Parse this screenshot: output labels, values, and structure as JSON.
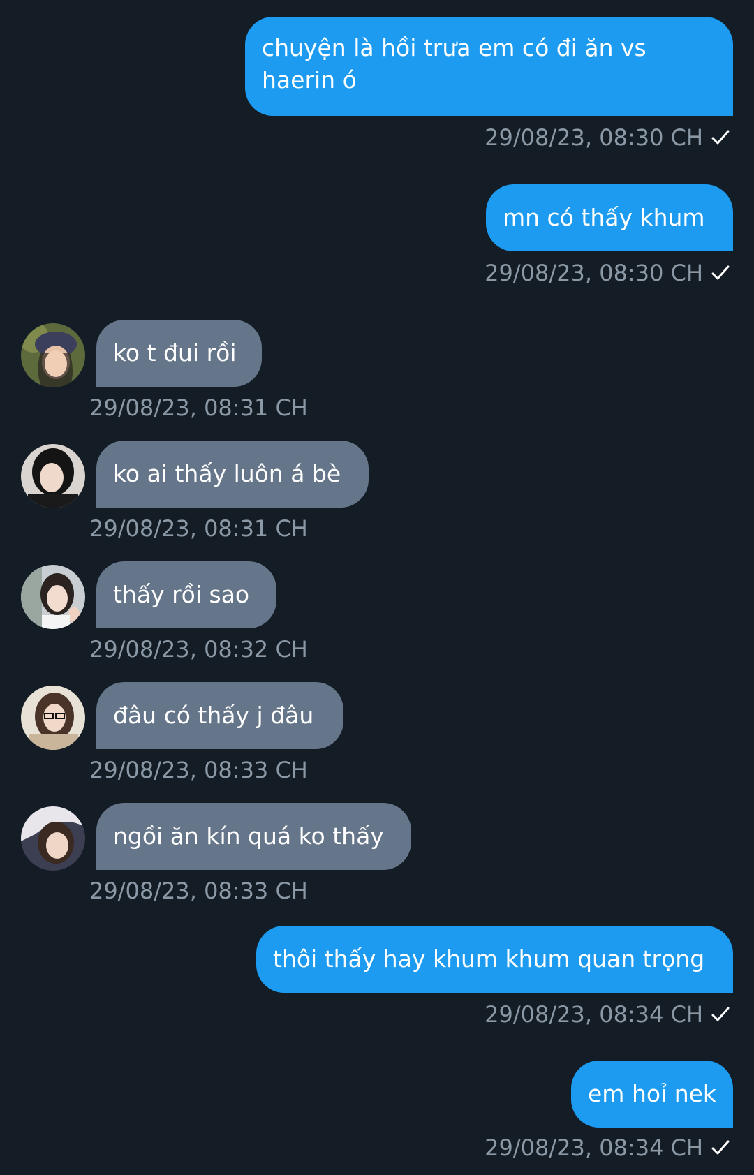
{
  "messages": [
    {
      "direction": "outgoing",
      "text": "chuyện là hồi trưa em có đi ăn vs haerin ó",
      "timestamp": "29/08/23,  08:30 CH",
      "status_icon": "check-icon"
    },
    {
      "direction": "outgoing",
      "text": "mn có thấy khum",
      "timestamp": "29/08/23,  08:30 CH",
      "status_icon": "check-icon"
    },
    {
      "direction": "incoming",
      "text": "ko t đui rồi",
      "timestamp": "29/08/23,  08:31 CH",
      "avatar": "avatar-1"
    },
    {
      "direction": "incoming",
      "text": "ko ai thấy luôn á bè",
      "timestamp": "29/08/23,  08:31 CH",
      "avatar": "avatar-2"
    },
    {
      "direction": "incoming",
      "text": "thấy rồi sao",
      "timestamp": "29/08/23,  08:32 CH",
      "avatar": "avatar-3"
    },
    {
      "direction": "incoming",
      "text": "đâu có thấy j đâu",
      "timestamp": "29/08/23,  08:33 CH",
      "avatar": "avatar-4"
    },
    {
      "direction": "incoming",
      "text": "ngồi ăn kín quá ko thấy",
      "timestamp": "29/08/23,  08:33 CH",
      "avatar": "avatar-5"
    },
    {
      "direction": "outgoing",
      "text": "thôi thấy hay khum khum quan trọng",
      "timestamp": "29/08/23,  08:34 CH",
      "status_icon": "check-icon"
    },
    {
      "direction": "outgoing",
      "text": "em hoỉ nek",
      "timestamp": "29/08/23,  08:34 CH",
      "status_icon": "check-icon"
    }
  ],
  "colors": {
    "background": "#141d26",
    "outgoing_bubble": "#1d9bf0",
    "incoming_bubble": "#66768a",
    "timestamp": "#8b98a5",
    "message_text": "#ffffff"
  }
}
